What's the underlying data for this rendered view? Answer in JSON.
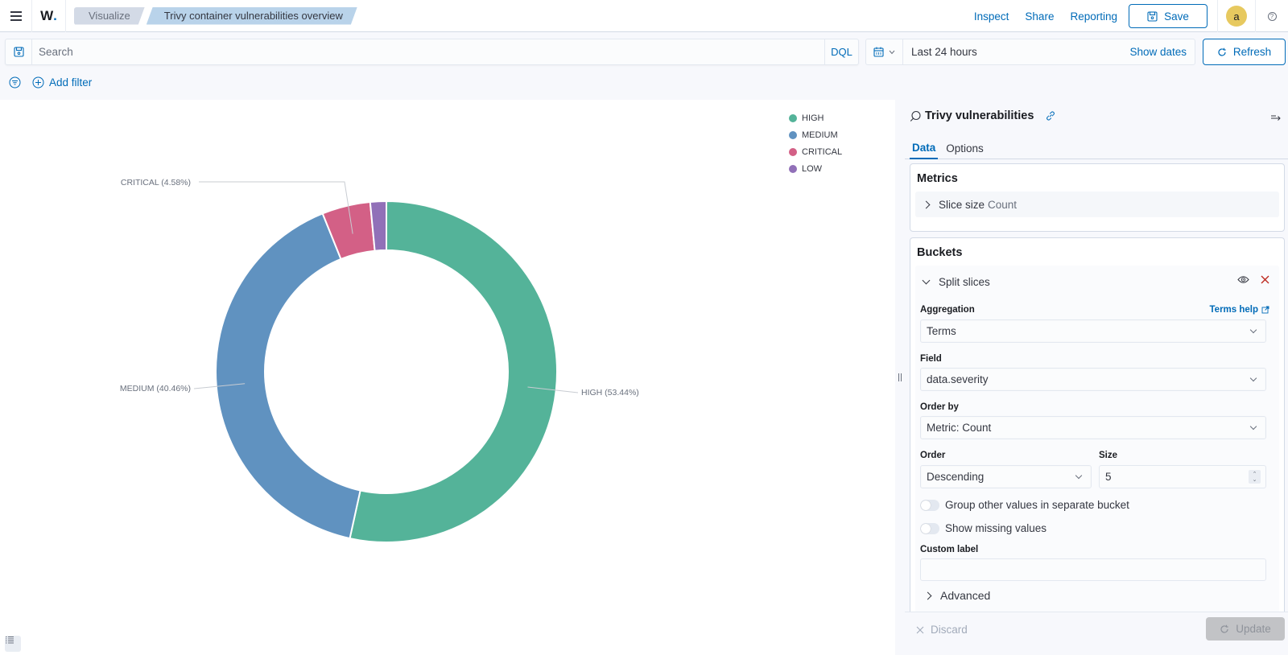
{
  "header": {
    "logo_text": "W",
    "logo_dot": ".",
    "breadcrumbs": [
      "Visualize",
      "Trivy container vulnerabilities overview"
    ],
    "links": [
      "Inspect",
      "Share",
      "Reporting"
    ],
    "save_label": "Save",
    "avatar_initial": "a",
    "help_glyph": "?"
  },
  "query": {
    "search_placeholder": "Search",
    "search_value": "",
    "language_label": "DQL",
    "date_range": "Last 24 hours",
    "show_dates_label": "Show dates",
    "refresh_label": "Refresh",
    "add_filter_label": "Add filter"
  },
  "chart_data": {
    "type": "pie",
    "donut": true,
    "title": "",
    "categories": [
      "HIGH",
      "MEDIUM",
      "CRITICAL",
      "LOW"
    ],
    "values": [
      53.44,
      40.46,
      4.58,
      1.52
    ],
    "unit": "percent",
    "colors": [
      "#54b399",
      "#6092c0",
      "#d36086",
      "#9170b8"
    ],
    "slice_labels": [
      "HIGH (53.44%)",
      "MEDIUM (40.46%)",
      "CRITICAL (4.58%)",
      ""
    ],
    "legend": {
      "position": "top-right",
      "entries": [
        "HIGH",
        "MEDIUM",
        "CRITICAL",
        "LOW"
      ]
    }
  },
  "sidebar": {
    "index_pattern": "Trivy vulnerabilities",
    "tabs": [
      "Data",
      "Options"
    ],
    "active_tab": "Data",
    "metrics": {
      "title": "Metrics",
      "item_label": "Slice size",
      "item_value": "Count"
    },
    "buckets": {
      "title": "Buckets",
      "item_label": "Split slices",
      "aggregation_label": "Aggregation",
      "aggregation_help": "Terms help",
      "aggregation_value": "Terms",
      "field_label": "Field",
      "field_value": "data.severity",
      "order_by_label": "Order by",
      "order_by_value": "Metric: Count",
      "order_label": "Order",
      "order_value": "Descending",
      "size_label": "Size",
      "size_value": "5",
      "group_other_label": "Group other values in separate bucket",
      "group_other_on": false,
      "show_missing_label": "Show missing values",
      "show_missing_on": false,
      "custom_label_label": "Custom label",
      "custom_label_value": "",
      "advanced_label": "Advanced"
    },
    "discard_label": "Discard",
    "update_label": "Update"
  }
}
